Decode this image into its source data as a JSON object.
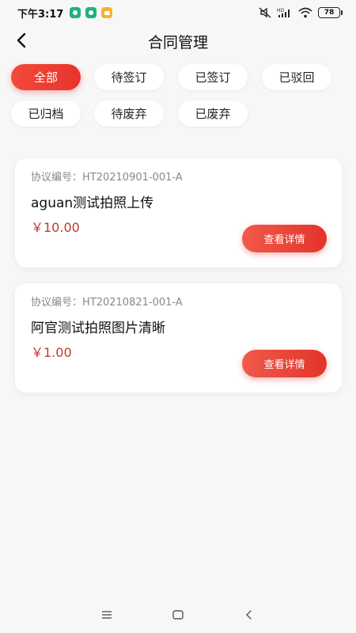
{
  "status_bar": {
    "time": "下午3:17",
    "battery": "78",
    "icons": [
      "app-notification-icon",
      "app-notification-icon",
      "message-icon",
      "mute-icon",
      "hd-signal-icon",
      "wifi-icon",
      "battery-icon"
    ]
  },
  "header": {
    "title": "合同管理",
    "back_icon": "back-arrow-icon"
  },
  "filters": [
    {
      "label": "全部",
      "active": true
    },
    {
      "label": "待签订",
      "active": false
    },
    {
      "label": "已签订",
      "active": false
    },
    {
      "label": "已驳回",
      "active": false
    },
    {
      "label": "已归档",
      "active": false
    },
    {
      "label": "待废弃",
      "active": false
    },
    {
      "label": "已废弃",
      "active": false
    }
  ],
  "contracts": [
    {
      "code_label": "协议编号：HT20210901-001-A",
      "name": "aguan测试拍照上传",
      "price": "￥10.00",
      "button": "查看详情"
    },
    {
      "code_label": "协议编号：HT20210821-001-A",
      "name": "阿官测试拍照图片清晰",
      "price": "￥1.00",
      "button": "查看详情"
    }
  ],
  "nav_bar": {
    "icons": [
      "menu-icon",
      "home-icon",
      "back-icon"
    ]
  },
  "colors": {
    "accent": "#e8332a",
    "price": "#c0392b",
    "background": "#f7f7f7"
  }
}
